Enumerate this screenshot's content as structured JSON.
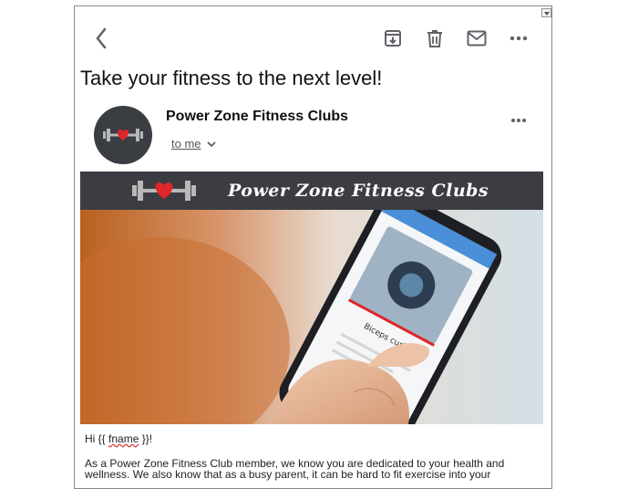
{
  "toolbar": {
    "back_icon": "chevron-left-icon",
    "archive_icon": "archive-icon",
    "delete_icon": "trash-icon",
    "mark_unread_icon": "mail-icon",
    "more_icon": "more-horizontal-icon"
  },
  "email": {
    "subject": "Take your fitness to the next level!",
    "sender": "Power Zone Fitness Clubs",
    "recipient": "to me",
    "greeting_prefix": "Hi {{ ",
    "greeting_name": "fname",
    "greeting_suffix": " }}!",
    "body_paragraph": "As a Power Zone Fitness Club member, we know you are dedicated to your health and wellness. We also know that as a busy parent, it can be hard to fit exercise into your"
  },
  "banner": {
    "title": "Power Zone Fitness Clubs"
  },
  "hero_image": {
    "screen_title": "Biceps curl"
  },
  "colors": {
    "banner_bg": "#3b3d42",
    "logo_heart": "#e0262b",
    "logo_dumbbell": "#b8b8b8"
  }
}
